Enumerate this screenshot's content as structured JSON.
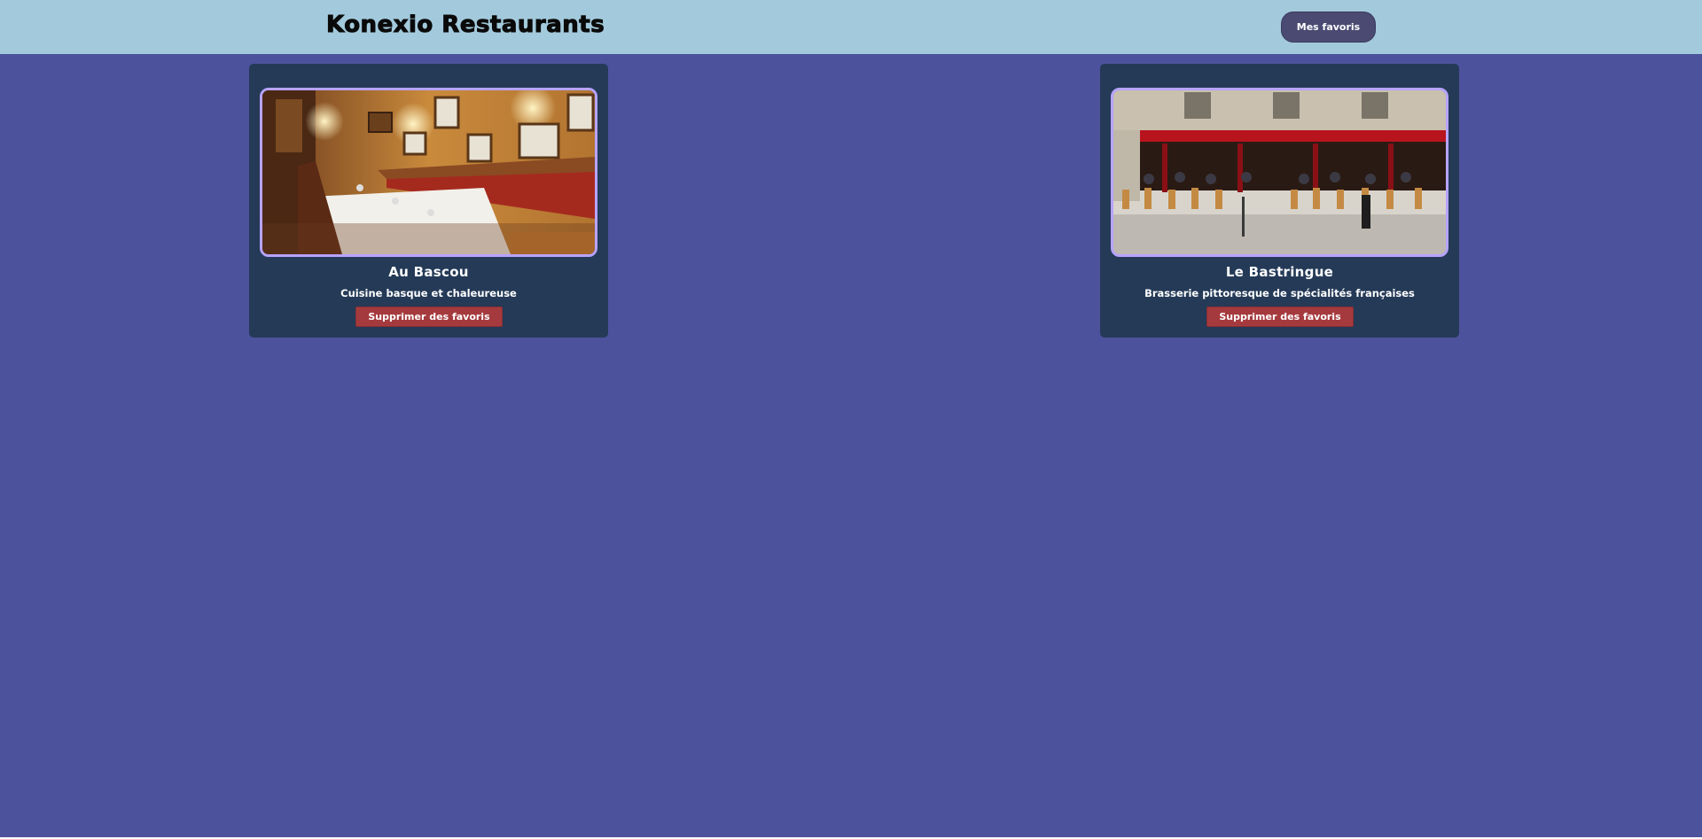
{
  "header": {
    "brand": "Konexio Restaurants",
    "favorites_button": "Mes favoris"
  },
  "restaurants": [
    {
      "name": "Au Bascou",
      "description": "Cuisine basque et chaleureuse",
      "remove_label": "Supprimer des favoris"
    },
    {
      "name": "Le Bastringue",
      "description": "Brasserie pittoresque de spécialités françaises",
      "remove_label": "Supprimer des favoris"
    }
  ],
  "colors": {
    "page_background": "#4d529c",
    "header_background": "#a3cadc",
    "card_background": "#243a57",
    "remove_button": "#a53a3e",
    "photo_border": "#b7a3ff"
  }
}
